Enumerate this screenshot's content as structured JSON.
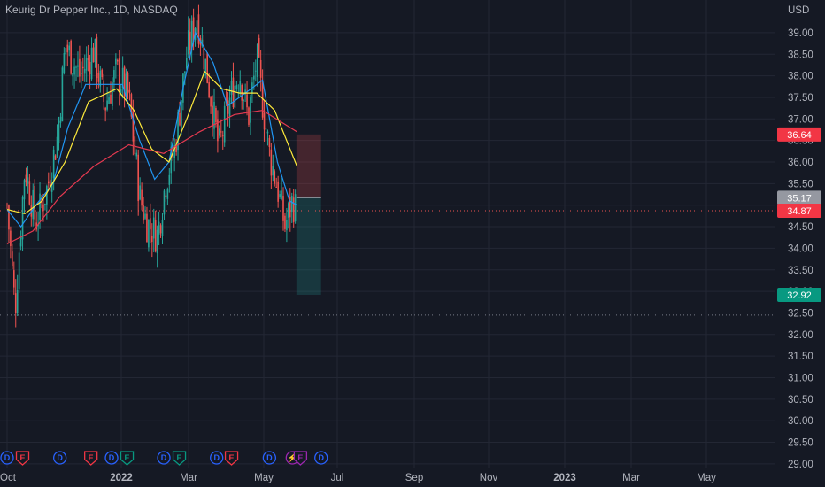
{
  "header": {
    "title": "Keurig Dr Pepper Inc., 1D, NASDAQ"
  },
  "colors": {
    "background": "#151924",
    "grid": "#232734",
    "axis_text": "#b2b5be",
    "up": "#26a69a",
    "down": "#ef5350",
    "ma_fast": "#2196f3",
    "ma_mid": "#ffeb3b",
    "ma_slow": "#e53950",
    "dividend": "#2962ff",
    "earnings": "#f23645",
    "esplit": "#089981",
    "flash": "#9c27b0"
  },
  "chart_data": {
    "type": "candlestick",
    "currency_label": "USD",
    "x_ticks": [
      "Oct",
      "2022",
      "Mar",
      "May",
      "Jul",
      "Sep",
      "Nov",
      "2023",
      "Mar",
      "May"
    ],
    "x_ticks_bold": [
      "2022",
      "2023"
    ],
    "y_ticks": [
      39.0,
      38.5,
      38.0,
      37.5,
      37.0,
      36.5,
      36.0,
      35.5,
      35.0,
      34.5,
      34.0,
      33.5,
      33.0,
      32.5,
      32.0,
      31.5,
      31.0,
      30.5,
      30.0,
      29.5,
      29.0
    ],
    "ylim": [
      28.8,
      39.9
    ],
    "price_path": [
      {
        "date": "2021-10-01",
        "value": 35.0
      },
      {
        "date": "2021-10-15",
        "value": 32.6
      },
      {
        "date": "2021-11-01",
        "value": 35.9
      },
      {
        "date": "2021-11-20",
        "value": 34.6
      },
      {
        "date": "2021-12-10",
        "value": 35.4
      },
      {
        "date": "2021-12-28",
        "value": 36.6
      },
      {
        "date": "2022-01-10",
        "value": 38.7
      },
      {
        "date": "2022-02-05",
        "value": 38.0
      },
      {
        "date": "2022-03-01",
        "value": 38.6
      },
      {
        "date": "2022-03-20",
        "value": 37.3
      },
      {
        "date": "2022-04-10",
        "value": 38.1
      },
      {
        "date": "2022-05-01",
        "value": 37.5
      },
      {
        "date": "2022-05-20",
        "value": 35.2
      },
      {
        "date": "2022-06-01",
        "value": 34.6
      },
      {
        "date": "2022-06-20",
        "value": 34.3
      },
      {
        "date": "2022-07-05",
        "value": 35.6
      },
      {
        "date": "2022-07-20",
        "value": 36.3
      },
      {
        "date": "2022-08-10",
        "value": 38.5
      },
      {
        "date": "2022-08-28",
        "value": 39.4
      },
      {
        "date": "2022-09-15",
        "value": 38.0
      },
      {
        "date": "2022-10-05",
        "value": 36.3
      },
      {
        "date": "2022-10-25",
        "value": 37.5
      },
      {
        "date": "2022-11-10",
        "value": 38.1
      },
      {
        "date": "2022-11-25",
        "value": 37.0
      },
      {
        "date": "2022-12-10",
        "value": 38.4
      },
      {
        "date": "2023-01-01",
        "value": 36.2
      },
      {
        "date": "2023-01-15",
        "value": 35.4
      },
      {
        "date": "2023-01-28",
        "value": 34.5
      },
      {
        "date": "2023-02-10",
        "value": 35.1
      },
      {
        "date": "2023-02-17",
        "value": 34.87
      }
    ],
    "moving_averages": [
      {
        "key": "ma_fast",
        "points": [
          {
            "date": "2021-10-01",
            "value": 34.9
          },
          {
            "date": "2021-10-25",
            "value": 34.5
          },
          {
            "date": "2021-11-20",
            "value": 35.0
          },
          {
            "date": "2021-12-20",
            "value": 35.5
          },
          {
            "date": "2022-01-15",
            "value": 36.8
          },
          {
            "date": "2022-02-15",
            "value": 37.8
          },
          {
            "date": "2022-03-25",
            "value": 37.8
          },
          {
            "date": "2022-04-20",
            "value": 37.8
          },
          {
            "date": "2022-05-20",
            "value": 36.5
          },
          {
            "date": "2022-06-15",
            "value": 35.6
          },
          {
            "date": "2022-07-10",
            "value": 36.0
          },
          {
            "date": "2022-08-05",
            "value": 37.8
          },
          {
            "date": "2022-08-25",
            "value": 39.0
          },
          {
            "date": "2022-09-25",
            "value": 38.3
          },
          {
            "date": "2022-10-20",
            "value": 37.3
          },
          {
            "date": "2022-11-20",
            "value": 37.6
          },
          {
            "date": "2022-12-20",
            "value": 37.9
          },
          {
            "date": "2023-01-15",
            "value": 36.0
          },
          {
            "date": "2023-02-05",
            "value": 35.1
          },
          {
            "date": "2023-02-18",
            "value": 35.0
          }
        ]
      },
      {
        "key": "ma_mid",
        "points": [
          {
            "date": "2021-10-01",
            "value": 34.9
          },
          {
            "date": "2021-11-01",
            "value": 34.8
          },
          {
            "date": "2021-12-01",
            "value": 35.1
          },
          {
            "date": "2022-01-10",
            "value": 36.0
          },
          {
            "date": "2022-02-20",
            "value": 37.4
          },
          {
            "date": "2022-04-10",
            "value": 37.7
          },
          {
            "date": "2022-05-10",
            "value": 37.2
          },
          {
            "date": "2022-06-10",
            "value": 36.3
          },
          {
            "date": "2022-07-10",
            "value": 36.0
          },
          {
            "date": "2022-08-10",
            "value": 37.0
          },
          {
            "date": "2022-09-10",
            "value": 38.1
          },
          {
            "date": "2022-10-10",
            "value": 37.7
          },
          {
            "date": "2022-11-10",
            "value": 37.6
          },
          {
            "date": "2022-12-10",
            "value": 37.6
          },
          {
            "date": "2023-01-10",
            "value": 37.2
          },
          {
            "date": "2023-02-18",
            "value": 35.9
          }
        ]
      },
      {
        "key": "ma_slow",
        "points": [
          {
            "date": "2021-10-01",
            "value": 34.1
          },
          {
            "date": "2021-11-15",
            "value": 34.4
          },
          {
            "date": "2022-01-01",
            "value": 35.2
          },
          {
            "date": "2022-03-01",
            "value": 35.9
          },
          {
            "date": "2022-05-01",
            "value": 36.4
          },
          {
            "date": "2022-07-01",
            "value": 36.2
          },
          {
            "date": "2022-09-01",
            "value": 36.7
          },
          {
            "date": "2022-11-01",
            "value": 37.1
          },
          {
            "date": "2022-12-20",
            "value": 37.2
          },
          {
            "date": "2023-02-18",
            "value": 36.7
          }
        ]
      }
    ],
    "reference_lines": [
      {
        "value": 34.87,
        "color": "#ef5350"
      },
      {
        "value": 32.45,
        "color": "#787b86"
      }
    ],
    "position_zones": [
      {
        "from": 36.64,
        "to": 35.17,
        "start": "2023-02-17",
        "end": "2023-04-01",
        "color": "#ef5350"
      },
      {
        "from": 35.17,
        "to": 32.92,
        "start": "2023-02-17",
        "end": "2023-04-01",
        "color": "#26a69a"
      }
    ],
    "price_labels": [
      {
        "text": "36.64",
        "value": 36.64,
        "color": "#f23645",
        "text_color": "#ffffff"
      },
      {
        "text": "35.17",
        "value": 35.17,
        "color": "#9598a1",
        "text_color": "#ffffff"
      },
      {
        "text": "34.87",
        "value": 34.87,
        "color": "#f23645",
        "text_color": "#ffffff"
      },
      {
        "text": "32.92",
        "value": 32.92,
        "color": "#089981",
        "text_color": "#ffffff"
      }
    ],
    "events": [
      {
        "label": "D",
        "kind": "dividend",
        "date": "2021-10-01"
      },
      {
        "label": "E",
        "kind": "earnings",
        "date": "2021-10-28"
      },
      {
        "label": "D",
        "kind": "dividend",
        "date": "2022-01-01"
      },
      {
        "label": "E",
        "kind": "earnings",
        "date": "2022-02-24"
      },
      {
        "label": "D",
        "kind": "dividend",
        "date": "2022-04-01"
      },
      {
        "label": "E",
        "kind": "esplit",
        "date": "2022-04-28"
      },
      {
        "label": "D",
        "kind": "dividend",
        "date": "2022-07-01"
      },
      {
        "label": "E",
        "kind": "esplit",
        "date": "2022-07-28"
      },
      {
        "label": "D",
        "kind": "dividend",
        "date": "2022-10-01"
      },
      {
        "label": "E",
        "kind": "earnings",
        "date": "2022-10-27"
      },
      {
        "label": "D",
        "kind": "dividend",
        "date": "2023-01-01"
      },
      {
        "label": "⚡",
        "kind": "flash",
        "date": "2023-02-10"
      },
      {
        "label": "E",
        "kind": "flash",
        "date": "2023-02-24"
      },
      {
        "label": "D",
        "kind": "dividend",
        "date": "2023-04-01"
      }
    ]
  }
}
